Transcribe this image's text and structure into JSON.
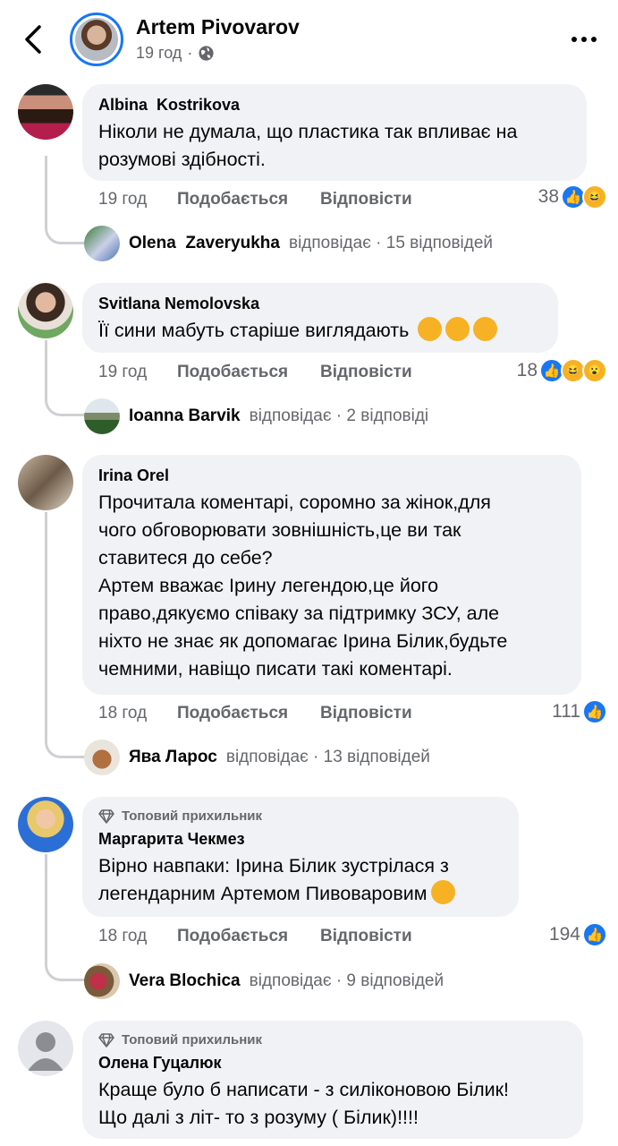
{
  "header": {
    "name": "Artem Pivovarov",
    "time": "19 год",
    "icons": {
      "back": "chevron-left-icon",
      "privacy": "globe-icon",
      "more": "more-horizontal-icon"
    }
  },
  "labels": {
    "like": "Подобається",
    "reply": "Відповісти"
  },
  "comments": [
    {
      "author": "Albina  Kostrikova",
      "text": "Ніколи не думала, що пластика так впливає на розумові здібності.",
      "time": "19 год",
      "count": "38",
      "reactions": [
        "like",
        "haha"
      ],
      "reply": {
        "name": "Olena  Zaveryukha",
        "meta": "відповідає · 15 відповідей"
      }
    },
    {
      "author": "Svitlana Nemolovska",
      "text": "Її сини мабуть старіше виглядають",
      "time": "19 год",
      "count": "18",
      "reactions": [
        "like",
        "haha",
        "wow"
      ],
      "reply": {
        "name": "Ioanna Barvik",
        "meta": "відповідає · 2 відповіді"
      }
    },
    {
      "author": "Irina Orel",
      "text": "Прочитала коментарі, соромно за жінок,для\nчого обговорювати зовнішність,це ви так\nставитеся до себе?\nАртем  вважає Ірину легендою,це його\nправо,дякуємо  співаку за підтримку ЗСУ, але\nніхто не знає як допомагає Ірина Білик,будьте\nчемними, навіщо писати  такі коментарі.",
      "time": "18 год",
      "count": "111",
      "reactions": [
        "like"
      ],
      "reply": {
        "name": "Ява Ларос",
        "meta": "відповідає · 13 відповідей"
      }
    },
    {
      "badge": "Топовий прихильник",
      "author": "Маргарита Чекмез",
      "text": "Вірно навпаки: Ірина Білик зустрілася з\nлегендарним Артемом Пивоваровим",
      "time": "18 год",
      "count": "194",
      "reactions": [
        "like"
      ],
      "reply": {
        "name": "Vera Blochica",
        "meta": "відповідає · 9 відповідей"
      }
    },
    {
      "badge": "Топовий прихильник",
      "author": "Олена Гуцалюк",
      "text": "Краще було б написати - з силіконовою Білик!\nЩо далі з літ- то з розуму ( Білик)!!!!"
    }
  ]
}
